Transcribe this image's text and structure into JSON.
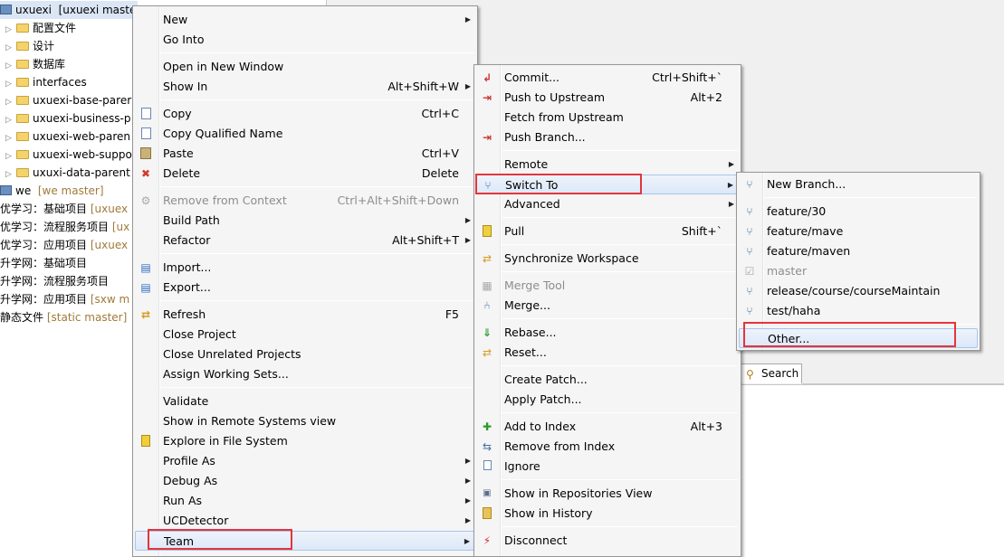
{
  "explorer": {
    "top_row": {
      "name": "uxuexi",
      "repo": "[uxuexi maste"
    },
    "folders": [
      "配置文件",
      "设计",
      "数据库",
      "interfaces",
      "uxuexi-base-parer",
      "uxuexi-business-p",
      "uxuexi-web-paren",
      "uxuexi-web-suppo",
      "uxuxi-data-parent"
    ],
    "we_row": {
      "name": "we",
      "repo": "[we master]"
    },
    "projects": [
      {
        "name": "优学习：基础项目",
        "repo": "[uxuex"
      },
      {
        "name": "优学习：流程服务项目",
        "repo": "[ux"
      },
      {
        "name": "优学习：应用项目",
        "repo": "[uxuex"
      },
      {
        "name": "升学网：基础项目",
        "repo": ""
      },
      {
        "name": "升学网：流程服务项目",
        "repo": ""
      },
      {
        "name": "升学网：应用项目",
        "repo": "[sxw m"
      },
      {
        "name": "静态文件",
        "repo": "[static master]"
      }
    ]
  },
  "search_tab": {
    "label": "Search"
  },
  "main_menu": {
    "items": [
      {
        "label": "New",
        "shortcut": "",
        "submenu": true,
        "icon": "",
        "disabled": false
      },
      {
        "label": "Go Into",
        "shortcut": "",
        "submenu": false,
        "icon": "",
        "disabled": false
      },
      {
        "label": "Open in New Window",
        "shortcut": "",
        "submenu": false,
        "icon": "",
        "disabled": false
      },
      {
        "label": "Show In",
        "shortcut": "Alt+Shift+W",
        "submenu": true,
        "icon": "",
        "disabled": false
      },
      {
        "label": "Copy",
        "shortcut": "Ctrl+C",
        "submenu": false,
        "icon": "copy-icon",
        "disabled": false
      },
      {
        "label": "Copy Qualified Name",
        "shortcut": "",
        "submenu": false,
        "icon": "",
        "disabled": false
      },
      {
        "label": "Paste",
        "shortcut": "Ctrl+V",
        "submenu": false,
        "icon": "paste-icon",
        "disabled": false
      },
      {
        "label": "Delete",
        "shortcut": "Delete",
        "submenu": false,
        "icon": "delete-icon",
        "disabled": false
      },
      {
        "label": "Remove from Context",
        "shortcut": "Ctrl+Alt+Shift+Down",
        "submenu": false,
        "icon": "remove-context-icon",
        "disabled": true
      },
      {
        "label": "Build Path",
        "shortcut": "",
        "submenu": true,
        "icon": "",
        "disabled": false
      },
      {
        "label": "Refactor",
        "shortcut": "Alt+Shift+T",
        "submenu": true,
        "icon": "",
        "disabled": false
      },
      {
        "label": "Import...",
        "shortcut": "",
        "submenu": false,
        "icon": "import-icon",
        "disabled": false
      },
      {
        "label": "Export...",
        "shortcut": "",
        "submenu": false,
        "icon": "export-icon",
        "disabled": false
      },
      {
        "label": "Refresh",
        "shortcut": "F5",
        "submenu": false,
        "icon": "refresh-icon",
        "disabled": false
      },
      {
        "label": "Close Project",
        "shortcut": "",
        "submenu": false,
        "icon": "",
        "disabled": false
      },
      {
        "label": "Close Unrelated Projects",
        "shortcut": "",
        "submenu": false,
        "icon": "",
        "disabled": false
      },
      {
        "label": "Assign Working Sets...",
        "shortcut": "",
        "submenu": false,
        "icon": "",
        "disabled": false
      },
      {
        "label": "Validate",
        "shortcut": "",
        "submenu": false,
        "icon": "",
        "disabled": false
      },
      {
        "label": "Show in Remote Systems view",
        "shortcut": "",
        "submenu": false,
        "icon": "",
        "disabled": false
      },
      {
        "label": "Explore in File System",
        "shortcut": "",
        "submenu": false,
        "icon": "explore-icon",
        "disabled": false
      },
      {
        "label": "Profile As",
        "shortcut": "",
        "submenu": true,
        "icon": "",
        "disabled": false
      },
      {
        "label": "Debug As",
        "shortcut": "",
        "submenu": true,
        "icon": "",
        "disabled": false
      },
      {
        "label": "Run As",
        "shortcut": "",
        "submenu": true,
        "icon": "",
        "disabled": false
      },
      {
        "label": "UCDetector",
        "shortcut": "",
        "submenu": true,
        "icon": "",
        "disabled": false
      },
      {
        "label": "Team",
        "shortcut": "",
        "submenu": true,
        "icon": "",
        "disabled": false
      }
    ]
  },
  "team_menu": {
    "items": [
      {
        "label": "Commit...",
        "shortcut": "Ctrl+Shift+`",
        "submenu": false,
        "icon": "commit-icon",
        "disabled": false
      },
      {
        "label": "Push to Upstream",
        "shortcut": "Alt+2",
        "submenu": false,
        "icon": "push-icon",
        "disabled": false
      },
      {
        "label": "Fetch from Upstream",
        "shortcut": "",
        "submenu": false,
        "icon": "",
        "disabled": false
      },
      {
        "label": "Push Branch...",
        "shortcut": "",
        "submenu": false,
        "icon": "push-branch-icon",
        "disabled": false
      },
      {
        "label": "Remote",
        "shortcut": "",
        "submenu": true,
        "icon": "",
        "disabled": false
      },
      {
        "label": "Switch To",
        "shortcut": "",
        "submenu": true,
        "icon": "branch-icon",
        "disabled": false
      },
      {
        "label": "Advanced",
        "shortcut": "",
        "submenu": true,
        "icon": "",
        "disabled": false
      },
      {
        "label": "Pull",
        "shortcut": "Shift+`",
        "submenu": false,
        "icon": "pull-icon",
        "disabled": false
      },
      {
        "label": "Synchronize Workspace",
        "shortcut": "",
        "submenu": false,
        "icon": "sync-icon",
        "disabled": false
      },
      {
        "label": "Merge Tool",
        "shortcut": "",
        "submenu": false,
        "icon": "merge-tool-icon",
        "disabled": true
      },
      {
        "label": "Merge...",
        "shortcut": "",
        "submenu": false,
        "icon": "merge-icon",
        "disabled": false
      },
      {
        "label": "Rebase...",
        "shortcut": "",
        "submenu": false,
        "icon": "rebase-icon",
        "disabled": false
      },
      {
        "label": "Reset...",
        "shortcut": "",
        "submenu": false,
        "icon": "reset-icon",
        "disabled": false
      },
      {
        "label": "Create Patch...",
        "shortcut": "",
        "submenu": false,
        "icon": "",
        "disabled": false
      },
      {
        "label": "Apply Patch...",
        "shortcut": "",
        "submenu": false,
        "icon": "",
        "disabled": false
      },
      {
        "label": "Add to Index",
        "shortcut": "Alt+3",
        "submenu": false,
        "icon": "add-index-icon",
        "disabled": false
      },
      {
        "label": "Remove from Index",
        "shortcut": "",
        "submenu": false,
        "icon": "remove-index-icon",
        "disabled": false
      },
      {
        "label": "Ignore",
        "shortcut": "",
        "submenu": false,
        "icon": "ignore-icon",
        "disabled": false
      },
      {
        "label": "Show in Repositories View",
        "shortcut": "",
        "submenu": false,
        "icon": "repositories-icon",
        "disabled": false
      },
      {
        "label": "Show in History",
        "shortcut": "",
        "submenu": false,
        "icon": "history-icon",
        "disabled": false
      },
      {
        "label": "Disconnect",
        "shortcut": "",
        "submenu": false,
        "icon": "disconnect-icon",
        "disabled": false
      }
    ]
  },
  "switch_menu": {
    "items": [
      {
        "label": "New Branch...",
        "icon": "new-branch-icon",
        "disabled": false
      },
      {
        "label": "feature/30",
        "icon": "branch-icon",
        "disabled": false
      },
      {
        "label": "feature/mave",
        "icon": "branch-icon",
        "disabled": false
      },
      {
        "label": "feature/maven",
        "icon": "branch-icon",
        "disabled": false
      },
      {
        "label": "master",
        "icon": "checked-branch-icon",
        "disabled": true
      },
      {
        "label": "release/course/courseMaintain",
        "icon": "branch-icon",
        "disabled": false
      },
      {
        "label": "test/haha",
        "icon": "branch-icon",
        "disabled": false
      },
      {
        "label": "Other...",
        "icon": "",
        "disabled": false
      }
    ]
  },
  "colors": {
    "highlight_border": "#e3353b",
    "menu_bg": "#f5f5f5",
    "selection": "#dce8f8"
  }
}
